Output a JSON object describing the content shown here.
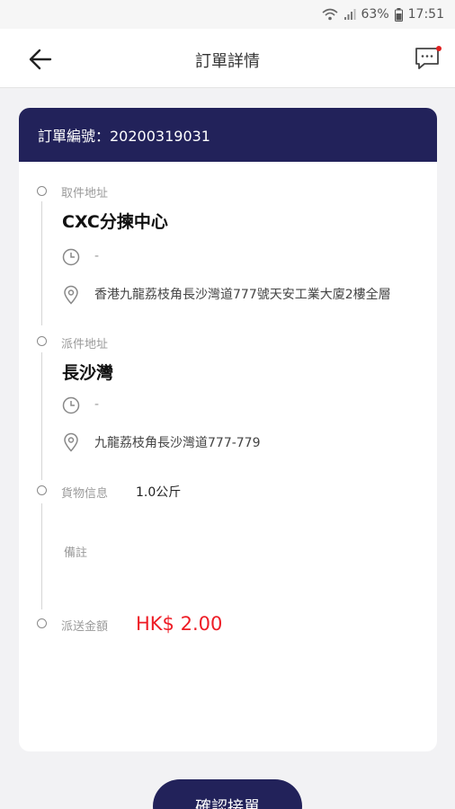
{
  "status_bar": {
    "battery_percent": "63%",
    "time": "17:51"
  },
  "header": {
    "title": "訂單詳情"
  },
  "order": {
    "number_label": "訂單編號：20200319031"
  },
  "pickup": {
    "label": "取件地址",
    "name": "CXC分揀中心",
    "time": "-",
    "address": "香港九龍荔枝角長沙灣道777號天安工業大廈2樓全層"
  },
  "delivery": {
    "label": "派件地址",
    "name": "長沙灣",
    "time": "-",
    "address": "九龍荔枝角長沙灣道777-779"
  },
  "goods": {
    "label": "貨物信息",
    "weight": "1.0公斤",
    "remark_label": "備註"
  },
  "fee": {
    "label": "派送金額",
    "amount": "HK$ 2.00"
  },
  "actions": {
    "confirm_label": "確認接單"
  },
  "colors": {
    "primary": "#22225a",
    "price": "#ee1c25",
    "notification_dot": "#e02020"
  }
}
